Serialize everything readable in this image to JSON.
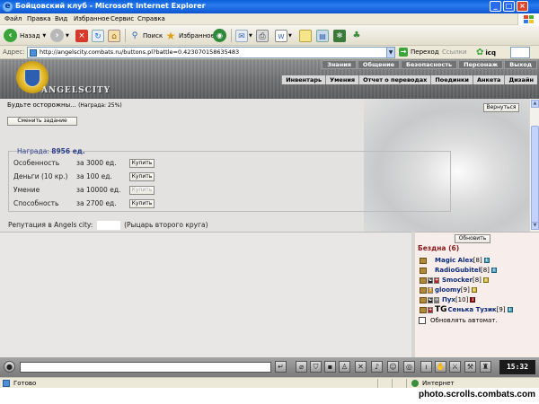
{
  "window": {
    "title": "Бойцовский клуб - Microsoft Internet Explorer"
  },
  "menu": [
    "Файл",
    "Правка",
    "Вид",
    "Избранное",
    "Сервис",
    "Справка"
  ],
  "toolbar": {
    "back": "Назад",
    "search": "Поиск",
    "favorites": "Избранное"
  },
  "address": {
    "label": "Адрес:",
    "url": "http://angelscity.combats.ru/buttons.pl?battle=0.423070158635483",
    "go": "Переход",
    "links": "Ссылки",
    "icq": "icq"
  },
  "game": {
    "logo_text": "ANGELSCITY",
    "top_nav": [
      "Знания",
      "Общение",
      "Безопасность",
      "Персонаж",
      "Выход"
    ],
    "sub_nav": [
      "Инвентарь",
      "Умения",
      "Отчет о переводах",
      "Поединки",
      "Анкета",
      "Дизайн"
    ],
    "warning_text": "Будьте осторожны...",
    "warning_reward": "(Награда: 25%)",
    "change_task_button": "Сменить задание",
    "back_button": "Вернуться",
    "reward_label": "Награда:",
    "reward_value": "8956 ед.",
    "buy_rows": [
      {
        "name": "Особенность",
        "price": "за 3000 ед.",
        "button": "Купить",
        "enabled": true
      },
      {
        "name": "Деньги (10 кр.)",
        "price": "за 100 ед.",
        "button": "Купить",
        "enabled": true
      },
      {
        "name": "Умение",
        "price": "за 10000 ед.",
        "button": "Купить",
        "enabled": false
      },
      {
        "name": "Способность",
        "price": "за 2700 ед.",
        "button": "Купить",
        "enabled": true
      }
    ],
    "reputation_label": "Репутация в Angels city:",
    "reputation_rank": "(Рыцарь второго круга)",
    "refresh_button": "Обновить",
    "room": "Бездна (6)",
    "users": [
      {
        "name": "Magic Alex",
        "level": "[8]"
      },
      {
        "name": "RadioGubitel",
        "level": "[8]"
      },
      {
        "name": "Smocker",
        "level": "[8]"
      },
      {
        "name": "gloomy",
        "level": "[9]"
      },
      {
        "name": "Пух",
        "level": "[10]"
      },
      {
        "name": "Сенька Тузик",
        "level": "[9]"
      }
    ],
    "auto_refresh": "Обновлять автомат.",
    "clock": "15:32"
  },
  "status": {
    "left": "Готово",
    "zone": "Интернет"
  },
  "watermark": "photo.scrolls.combats.com",
  "colors": {
    "title_bar": "#0a5fd8",
    "room_name": "#8b1a1a",
    "nick": "#0a2a78",
    "reward": "#2a3d88"
  }
}
